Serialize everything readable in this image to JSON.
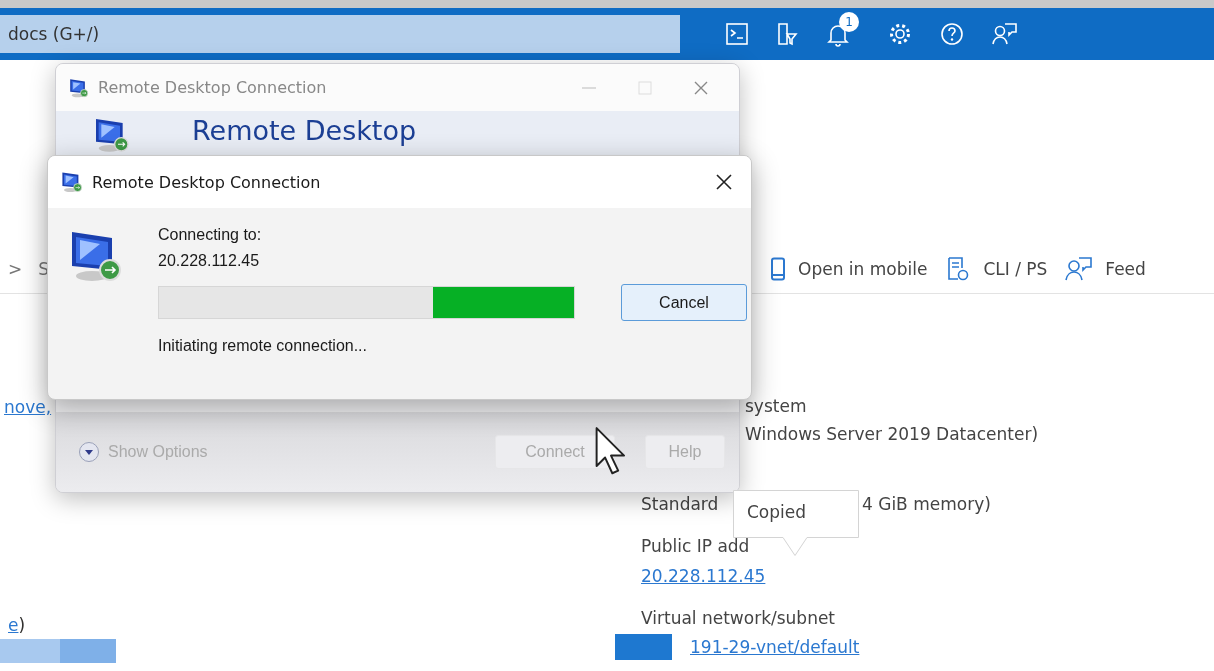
{
  "portal_header": {
    "search": {
      "value": "docs (G+/)"
    },
    "notification_badge": "1"
  },
  "command_bar": {
    "chevron": ">",
    "breadcrumb": "S",
    "commands": [
      {
        "kind": "mobile",
        "label": "Open in mobile"
      },
      {
        "kind": "cli",
        "label": "CLI / PS"
      },
      {
        "kind": "feedback",
        "label": "Feed"
      }
    ]
  },
  "left_column": {
    "link_top": "nove,",
    "link_bottom": "e",
    "text_bottom": ")"
  },
  "properties": {
    "os_label": "system",
    "os_value": "Windows Server 2019 Datacenter)",
    "size_value": "Standard",
    "size_value_end": "4 GiB memory)",
    "ip_label": "Public IP add",
    "ip_link": "20.228.112.45",
    "vnet_label": "Virtual network/subnet",
    "vnet_link": "191-29-vnet/default"
  },
  "back_dialog": {
    "title": "Remote Desktop Connection",
    "banner": "Remote Desktop",
    "show_options": "Show Options",
    "buttons": [
      "Connect",
      "Help"
    ]
  },
  "front_dialog": {
    "title": "Remote Desktop Connection",
    "connecting_label": "Connecting to:",
    "address": "20.228.112.45",
    "progress": {
      "level": 0.34
    },
    "cancel": "Cancel",
    "status": "Initiating remote connection..."
  },
  "tooltip": {
    "text": "Copied"
  }
}
